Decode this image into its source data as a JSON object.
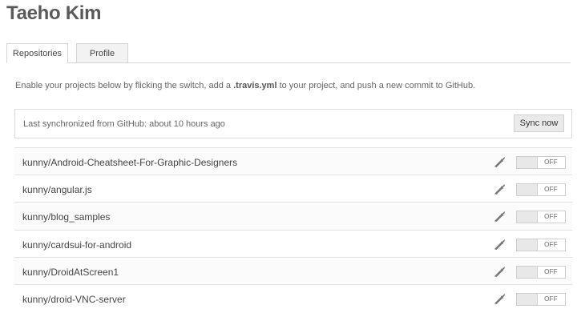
{
  "profile": {
    "name": "Taeho Kim"
  },
  "tabs": [
    {
      "label": "Repositories",
      "active": true
    },
    {
      "label": "Profile",
      "active": false
    }
  ],
  "intro": {
    "before": "Enable your projects below by flicking the switch, add a ",
    "code": ".travis.yml",
    "after": " to your project, and push a new commit to GitHub."
  },
  "sync": {
    "status": "Last synchronized from GitHub: about 10 hours ago",
    "button_label": "Sync now"
  },
  "repositories": [
    {
      "name": "kunny/Android-Cheatsheet-For-Graphic-Designers",
      "toggle": "OFF"
    },
    {
      "name": "kunny/angular.js",
      "toggle": "OFF"
    },
    {
      "name": "kunny/blog_samples",
      "toggle": "OFF"
    },
    {
      "name": "kunny/cardsui-for-android",
      "toggle": "OFF"
    },
    {
      "name": "kunny/DroidAtScreen1",
      "toggle": "OFF"
    },
    {
      "name": "kunny/droid-VNC-server",
      "toggle": "OFF"
    }
  ],
  "icons": {
    "settings": "wrench-icon"
  }
}
